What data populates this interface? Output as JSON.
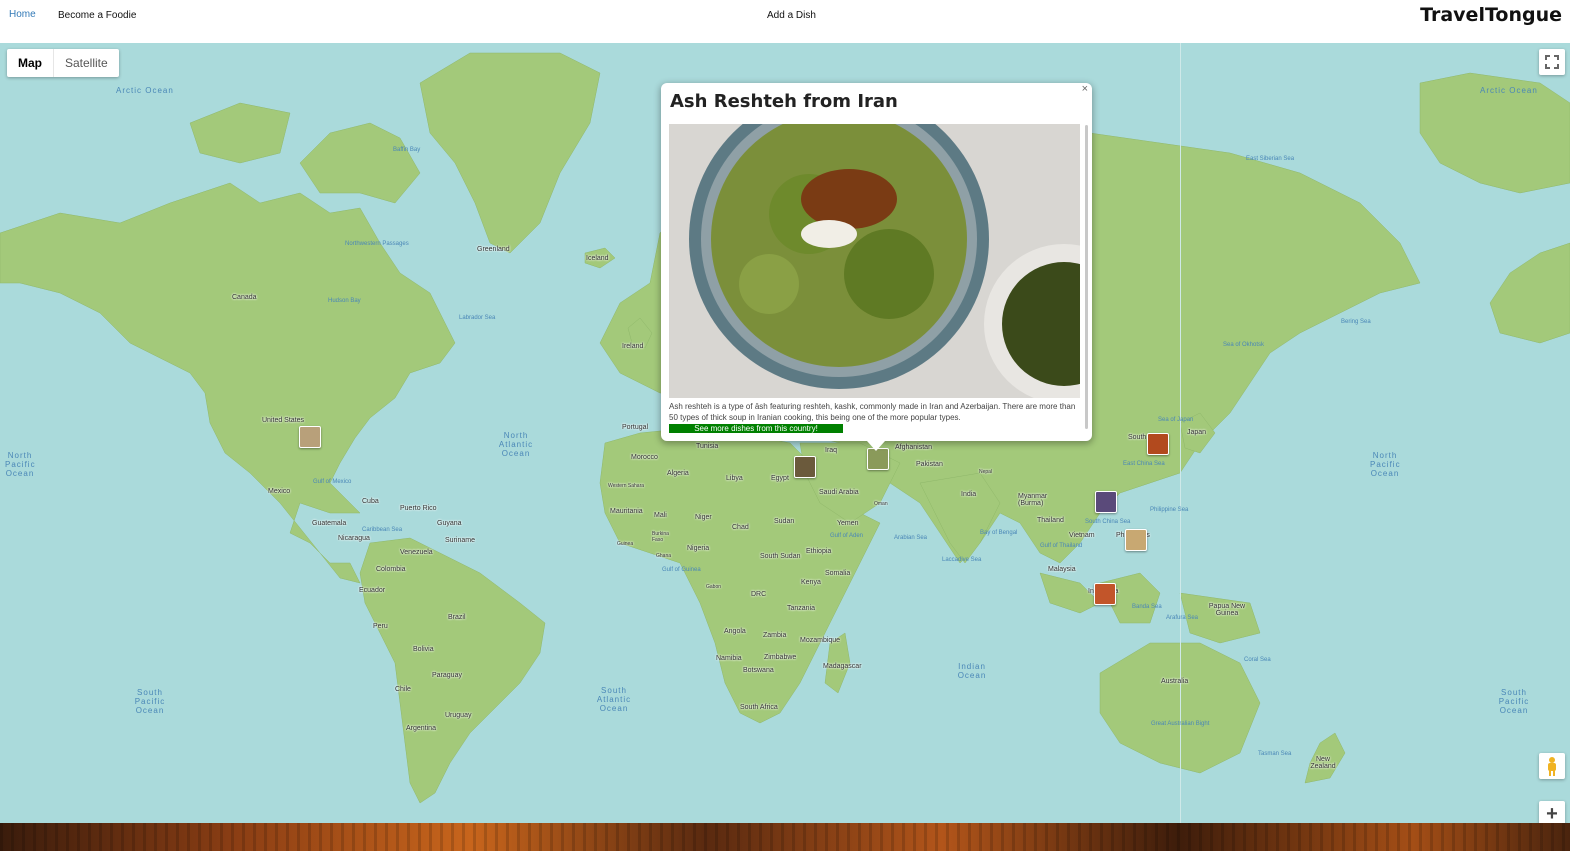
{
  "nav": {
    "home": "Home",
    "become_foodie": "Become a Foodie",
    "add_dish": "Add a Dish",
    "brand": "TravelTongue"
  },
  "map_controls": {
    "map_label": "Map",
    "satellite_label": "Satellite",
    "selected_type": "Map",
    "fullscreen_icon": "fullscreen-icon",
    "pegman_icon": "pegman-icon",
    "zoom_in_label": "+"
  },
  "colors": {
    "water": "#aadadb",
    "land": "#a3c97a",
    "link_green": "#008000",
    "nav_link": "#337ab7"
  },
  "oceans": {
    "arctic_left": "Arctic Ocean",
    "arctic_right": "Arctic Ocean",
    "north_pacific_left": "North Pacific Ocean",
    "north_pacific_right": "North Pacific Ocean",
    "north_atlantic": "North Atlantic Ocean",
    "south_pacific_left": "South Pacific Ocean",
    "south_pacific_right": "South Pacific Ocean",
    "south_atlantic": "South Atlantic Ocean",
    "indian": "Indian Ocean"
  },
  "seas": [
    "Baffin Bay",
    "Hudson Bay",
    "Labrador Sea",
    "Gulf of Mexico",
    "Caribbean Sea",
    "Arabian Sea",
    "Bay of Bengal",
    "Laccadive Sea",
    "Philippine Sea",
    "South China Sea",
    "East China Sea",
    "Sea of Japan",
    "Sea of Okhotsk",
    "Bering Sea",
    "East Siberian Sea",
    "Banda Sea",
    "Arafura Sea",
    "Coral Sea",
    "Tasman Sea",
    "Great Australian Bight",
    "Gulf of Aden",
    "Gulf of Guinea",
    "Gulf of Thailand",
    "Northwestern Passages"
  ],
  "places": {
    "canada": "Canada",
    "united_states": "United States",
    "mexico": "Mexico",
    "greenland": "Greenland",
    "iceland": "Iceland",
    "ireland": "Ireland",
    "portugal": "Portugal",
    "cuba": "Cuba",
    "puerto_rico": "Puerto Rico",
    "guatemala": "Guatemala",
    "nicaragua": "Nicaragua",
    "venezuela": "Venezuela",
    "colombia": "Colombia",
    "guyana": "Guyana",
    "suriname": "Suriname",
    "ecuador": "Ecuador",
    "peru": "Peru",
    "brazil": "Brazil",
    "bolivia": "Bolivia",
    "paraguay": "Paraguay",
    "chile": "Chile",
    "uruguay": "Uruguay",
    "argentina": "Argentina",
    "morocco": "Morocco",
    "algeria": "Algeria",
    "libya": "Libya",
    "egypt": "Egypt",
    "tunisia": "Tunisia",
    "western_sahara": "Western Sahara",
    "mauritania": "Mauritania",
    "mali": "Mali",
    "niger": "Niger",
    "chad": "Chad",
    "sudan": "Sudan",
    "guinea": "Guinea",
    "burkina_faso": "Burkina Faso",
    "ghana": "Ghana",
    "nigeria": "Nigeria",
    "ethiopia": "Ethiopia",
    "south_sudan": "South Sudan",
    "somalia": "Somalia",
    "kenya": "Kenya",
    "gabon": "Gabon",
    "drc": "DRC",
    "tanzania": "Tanzania",
    "angola": "Angola",
    "zambia": "Zambia",
    "mozambique": "Mozambique",
    "namibia": "Namibia",
    "zimbabwe": "Zimbabwe",
    "botswana": "Botswana",
    "madagascar": "Madagascar",
    "south_africa": "South Africa",
    "iraq": "Iraq",
    "saudi_arabia": "Saudi Arabia",
    "yemen": "Yemen",
    "oman": "Oman",
    "afghanistan": "Afghanistan",
    "pakistan": "Pakistan",
    "india": "India",
    "nepal": "Nepal",
    "myanmar": "Myanmar (Burma)",
    "thailand": "Thailand",
    "vietnam": "Vietnam",
    "malaysia": "Malaysia",
    "philippines": "Philippines",
    "indonesia": "Indonesia",
    "papua_new_guinea": "Papua New Guinea",
    "australia": "Australia",
    "new_zealand": "New Zealand",
    "japan": "Japan",
    "south_korea": "South"
  },
  "markers": [
    {
      "name": "marker-usa",
      "color": "#b8a07a"
    },
    {
      "name": "marker-turkey",
      "color": "#6b5a3c"
    },
    {
      "name": "marker-iran",
      "color": "#8a9a5a"
    },
    {
      "name": "marker-korea",
      "color": "#b24a1e"
    },
    {
      "name": "marker-china",
      "color": "#5a4a7a"
    },
    {
      "name": "marker-philippines",
      "color": "#c8a872"
    },
    {
      "name": "marker-indonesia",
      "color": "#c2552a"
    }
  ],
  "popup": {
    "title": "Ash Reshteh from Iran",
    "description": "Ash reshteh is a type of āsh featuring reshteh, kashk, commonly made in Iran and Azerbaijan. There are more than 50 types of thick soup in Iranian cooking, this being one of the more popular types.",
    "link": "See more dishes from this country!",
    "close": "×"
  }
}
